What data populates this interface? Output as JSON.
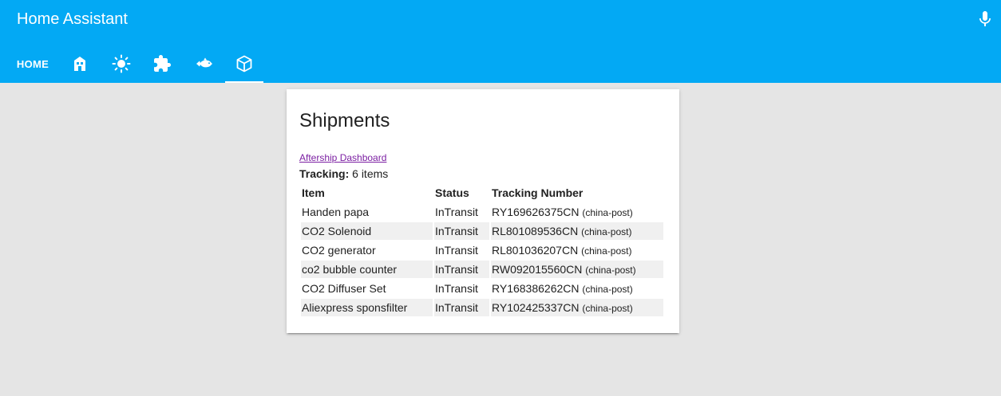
{
  "app": {
    "title": "Home Assistant"
  },
  "header": {
    "mic_icon": "microphone-icon"
  },
  "tabs": [
    {
      "label": "HOME",
      "icon": null,
      "selected": false
    },
    {
      "label": "",
      "icon": "home-building-icon",
      "selected": false
    },
    {
      "label": "",
      "icon": "weather-sunny-icon",
      "selected": false
    },
    {
      "label": "",
      "icon": "puzzle-icon",
      "selected": false
    },
    {
      "label": "",
      "icon": "fish-icon",
      "selected": false
    },
    {
      "label": "",
      "icon": "package-icon",
      "selected": true
    }
  ],
  "card": {
    "title": "Shipments",
    "link_text": "Aftership Dashboard",
    "tracking_label": "Tracking:",
    "tracking_count": "6 items",
    "columns": [
      "Item",
      "Status",
      "Tracking Number"
    ],
    "rows": [
      {
        "item": "Handen papa",
        "status": "InTransit",
        "tracking": "RY169626375CN",
        "carrier": "(china-post)"
      },
      {
        "item": "CO2 Solenoid",
        "status": "InTransit",
        "tracking": "RL801089536CN",
        "carrier": "(china-post)"
      },
      {
        "item": "CO2 generator",
        "status": "InTransit",
        "tracking": "RL801036207CN",
        "carrier": "(china-post)"
      },
      {
        "item": "co2 bubble counter",
        "status": "InTransit",
        "tracking": "RW092015560CN",
        "carrier": "(china-post)"
      },
      {
        "item": "CO2 Diffuser Set",
        "status": "InTransit",
        "tracking": "RY168386262CN",
        "carrier": "(china-post)"
      },
      {
        "item": "Aliexpress sponsfilter",
        "status": "InTransit",
        "tracking": "RY102425337CN",
        "carrier": "(china-post)"
      }
    ]
  },
  "colors": {
    "primary": "#03a9f4",
    "background": "#e5e5e5",
    "link": "#7b1fa2",
    "row_alt": "#f0f0f0"
  }
}
